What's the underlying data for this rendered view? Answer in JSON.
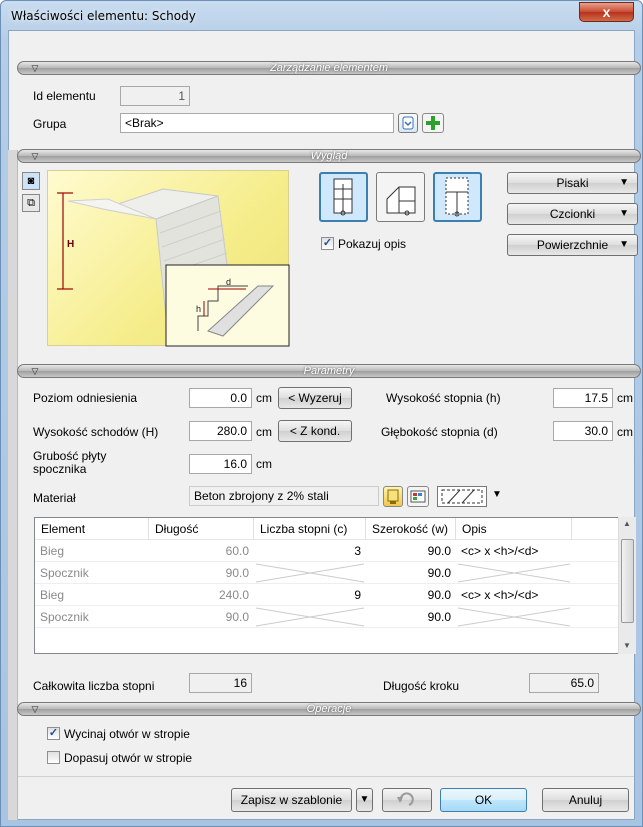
{
  "window": {
    "title": "Właściwości elementu: Schody",
    "close_glyph": "x"
  },
  "sections": {
    "management": "Zarządzanie elementem",
    "appearance": "Wygląd",
    "parameters": "Parametry",
    "operations": "Operacje"
  },
  "management": {
    "id_label": "Id elementu",
    "id_value": "1",
    "group_label": "Grupa",
    "group_value": "<Brak>"
  },
  "appearance": {
    "pens_label": "Pisaki",
    "fonts_label": "Czcionki",
    "surfaces_label": "Powierzchnie",
    "show_desc_label": "Pokazuj opis",
    "show_desc_checked": true,
    "preview_labels": {
      "H": "H",
      "h": "h",
      "d": "d"
    }
  },
  "parameters": {
    "ref_level_label": "Poziom odniesienia",
    "ref_level_value": "0.0",
    "ref_level_unit": "cm",
    "reset_button": "< Wyzeruj",
    "stair_height_label": "Wysokość schodów (H)",
    "stair_height_value": "280.0",
    "stair_height_unit": "cm",
    "from_cond_button": "< Z kond.",
    "landing_thickness_label_1": "Grubość płyty",
    "landing_thickness_label_2": "spocznika",
    "landing_thickness_value": "16.0",
    "landing_thickness_unit": "cm",
    "step_height_label": "Wysokość stopnia (h)",
    "step_height_value": "17.5",
    "step_height_unit": "cm",
    "step_depth_label": "Głębokość stopnia (d)",
    "step_depth_value": "30.0",
    "step_depth_unit": "cm",
    "material_label": "Materiał",
    "material_value": "Beton zbrojony z 2% stali"
  },
  "table": {
    "columns": [
      "Element",
      "Długość",
      "Liczba stopni (c)",
      "Szerokość (w)",
      "Opis"
    ],
    "rows": [
      {
        "element": "Bieg",
        "length": "60.0",
        "steps": "3",
        "width": "90.0",
        "desc": "<c> x <h>/<d>"
      },
      {
        "element": "Spocznik",
        "length": "90.0",
        "steps": "",
        "width": "90.0",
        "desc": ""
      },
      {
        "element": "Bieg",
        "length": "240.0",
        "steps": "9",
        "width": "90.0",
        "desc": "<c> x <h>/<d>"
      },
      {
        "element": "Spocznik",
        "length": "90.0",
        "steps": "",
        "width": "90.0",
        "desc": ""
      }
    ]
  },
  "summary": {
    "total_steps_label": "Całkowita liczba stopni",
    "total_steps_value": "16",
    "step_length_label": "Długość kroku",
    "step_length_value": "65.0"
  },
  "operations": {
    "cut_opening_label": "Wycinaj otwór w stropie",
    "cut_opening_checked": true,
    "fit_opening_label": "Dopasuj otwór w stropie",
    "fit_opening_checked": false
  },
  "footer": {
    "save_template": "Zapisz w szablonie",
    "ok": "OK",
    "cancel": "Anuluj"
  }
}
